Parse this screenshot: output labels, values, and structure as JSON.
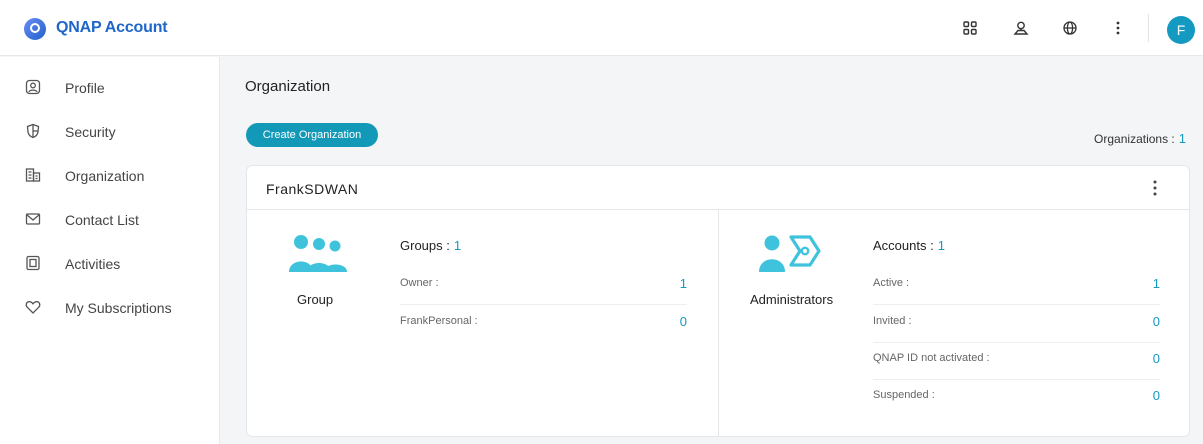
{
  "header": {
    "app_title": "QNAP Account",
    "avatar_initial": "F",
    "icons": [
      "apps-grid-icon",
      "location-icon",
      "globe-icon",
      "more-vertical-icon"
    ]
  },
  "sidebar": {
    "items": [
      {
        "label": "Profile",
        "icon": "profile-icon"
      },
      {
        "label": "Security",
        "icon": "shield-icon"
      },
      {
        "label": "Organization",
        "icon": "building-icon"
      },
      {
        "label": "Contact List",
        "icon": "mail-icon"
      },
      {
        "label": "Activities",
        "icon": "document-icon"
      },
      {
        "label": "My Subscriptions",
        "icon": "heart-icon"
      }
    ]
  },
  "main": {
    "title": "Organization",
    "create_button": "Create Organization",
    "organizations_label": "Organizations :",
    "organizations_count": "1",
    "org": {
      "name": "FrankSDWAN",
      "group": {
        "label": "Group",
        "title": "Groups :",
        "count": "1",
        "rows": [
          {
            "label": "Owner :",
            "value": "1"
          },
          {
            "label": "FrankPersonal :",
            "value": "0"
          }
        ]
      },
      "admins": {
        "label": "Administrators",
        "title": "Accounts :",
        "count": "1",
        "rows": [
          {
            "label": "Active :",
            "value": "1"
          },
          {
            "label": "Invited :",
            "value": "0"
          },
          {
            "label": "QNAP ID not activated :",
            "value": "0"
          },
          {
            "label": "Suspended :",
            "value": "0"
          }
        ]
      }
    }
  },
  "colors": {
    "accent": "#1499c1",
    "brand": "#1e66c9",
    "button": "#1399b8",
    "illustration": "#3fc3dc"
  }
}
